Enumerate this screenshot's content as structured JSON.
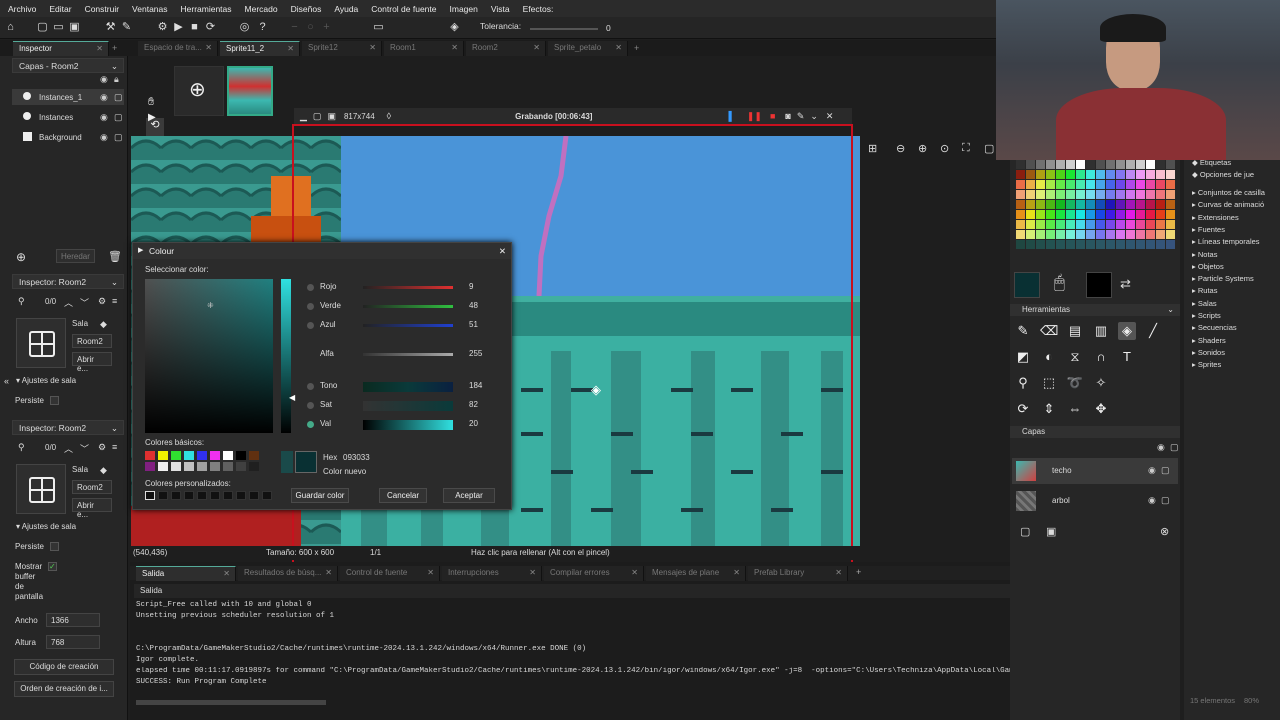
{
  "menu": [
    "Archivo",
    "Editar",
    "Construir",
    "Ventanas",
    "Herramientas",
    "Mercado",
    "Diseños",
    "Ayuda",
    "Control de fuente",
    "Imagen",
    "Vista",
    "Efectos:"
  ],
  "toolbar": {
    "tolerance_label": "Tolerancia:",
    "tolerance_value": "0"
  },
  "tabs": [
    {
      "label": "Inspector",
      "active": true
    },
    {
      "label": "Espacio de tra...",
      "active": false
    },
    {
      "label": "Sprite11_2",
      "active": true
    },
    {
      "label": "Sprite12",
      "active": false
    },
    {
      "label": "Room1",
      "active": false
    },
    {
      "label": "Room2",
      "active": false
    },
    {
      "label": "Sprite_petalo",
      "active": false
    }
  ],
  "left": {
    "layers_dropdown": "Capas - Room2",
    "layers": [
      {
        "name": "Instances_1"
      },
      {
        "name": "Instances"
      },
      {
        "name": "Background"
      }
    ],
    "heredar": "Heredar",
    "inspector1": {
      "title": "Inspector: Room2",
      "count": "0/0",
      "sala": "Sala",
      "room": "Room2",
      "open": "Abrir e...",
      "section": "Ajustes de sala",
      "persist": "Persiste"
    },
    "inspector2": {
      "title": "Inspector: Room2",
      "count": "0/0",
      "sala": "Sala",
      "room": "Room2",
      "open": "Abrir e...",
      "section": "Ajustes de sala",
      "persist": "Persiste",
      "show_buffer": [
        "Mostrar",
        "buffer",
        "de",
        "pantalla"
      ],
      "width_label": "Ancho",
      "width_value": "1366",
      "height_label": "Altura",
      "height_value": "768",
      "creation_code": "Código de creación",
      "creation_order": "Orden de creación de i..."
    }
  },
  "recorder": {
    "resolution": "817x744",
    "status": "Grabando [00:06:43]"
  },
  "colour_dialog": {
    "title": "Colour",
    "select_label": "Seleccionar color:",
    "sliders": [
      {
        "label": "Rojo",
        "value": "9",
        "color": "#e03030"
      },
      {
        "label": "Verde",
        "value": "48",
        "color": "#30c040"
      },
      {
        "label": "Azul",
        "value": "51",
        "color": "#2040d0"
      },
      {
        "label": "Alfa",
        "value": "255",
        "color": "#888888"
      },
      {
        "label": "Tono",
        "value": "184",
        "color": "#1a4a4a"
      },
      {
        "label": "Sat",
        "value": "82",
        "color": "#2a3a3a"
      },
      {
        "label": "Val",
        "value": "20",
        "color": "#30d0d0"
      }
    ],
    "basic_label": "Colores básicos:",
    "custom_label": "Colores personalizados:",
    "hex_label": "Hex",
    "hex_value": "093033",
    "new_color": "Color nuevo",
    "save": "Guardar color",
    "cancel": "Cancelar",
    "accept": "Aceptar",
    "basic_colors": [
      "#e03030",
      "#f0f000",
      "#30e030",
      "#30e0e0",
      "#3030f0",
      "#f030f0",
      "#ffffff",
      "#000000",
      "#603010",
      "#802080",
      "#f0f0f0",
      "#e0e0e0",
      "#c0c0c0",
      "#a0a0a0",
      "#808080",
      "#606060",
      "#404040",
      "#202020"
    ]
  },
  "status": {
    "coords": "(540,436)",
    "size": "Tamaño: 600 x 600",
    "frame": "1/1",
    "hint": "Haz clic para rellenar (Alt con el pincel)"
  },
  "output": {
    "tabs": [
      "Salida",
      "Resultados de búsq...",
      "Control de fuente",
      "Interrupciones",
      "Compilar errores",
      "Mensajes de plane",
      "Prefab Library"
    ],
    "title": "Salida",
    "lines": [
      "Script_Free called with 10 and global 0",
      "Unsetting previous scheduler resolution of 1",
      "",
      "",
      "C:\\ProgramData/GameMakerStudio2/Cache/runtimes\\runtime-2024.13.1.242/windows/x64/Runner.exe DONE (0)",
      "Igor complete.",
      "elapsed time 00:11:17.0919897s for command \"C:\\ProgramData/GameMakerStudio2/Cache/runtimes\\runtime-2024.13.1.242/bin/igor/windows/x64/Igor.exe\" -j=8  -options=\"C:\\Users\\Techniza\\AppData\\Local\\GameMakerStudio2\\GMS2TEM",
      "SUCCESS: Run Program Complete"
    ]
  },
  "right": {
    "tools_title": "Herramientas",
    "layers_title": "Capas",
    "layers": [
      {
        "name": "techo"
      },
      {
        "name": "arbol"
      }
    ]
  },
  "assets": [
    "Etiquetas",
    "Opciones de jue",
    "Conjuntos de casilla",
    "Curvas de animació",
    "Extensiones",
    "Fuentes",
    "Líneas temporales",
    "Notas",
    "Objetos",
    "Particle Systems",
    "Rutas",
    "Salas",
    "Scripts",
    "Secuencias",
    "Shaders",
    "Sonidos",
    "Sprites"
  ],
  "assets_footer": "15 elementos",
  "zoom": "80%"
}
